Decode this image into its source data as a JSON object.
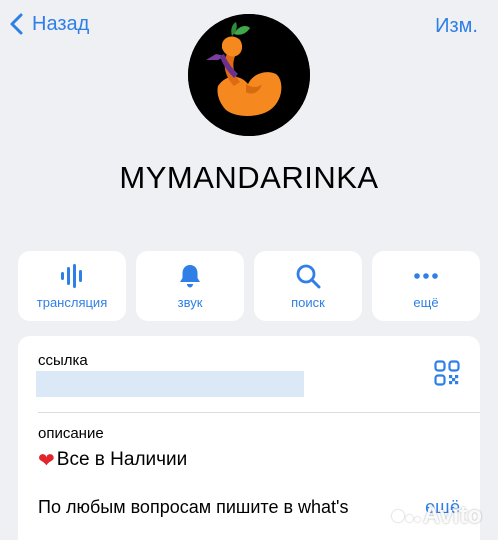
{
  "nav": {
    "back_label": "Назад",
    "edit_label": "Изм."
  },
  "channel": {
    "name": "MYMANDARINKA",
    "avatar_icon": "duck-mandarin-logo"
  },
  "actions": [
    {
      "label": "трансляция",
      "icon": "broadcast-icon"
    },
    {
      "label": "звук",
      "icon": "bell-icon"
    },
    {
      "label": "поиск",
      "icon": "search-icon"
    },
    {
      "label": "ещё",
      "icon": "more-dots-icon"
    }
  ],
  "info": {
    "link_label": "ссылка",
    "description_label": "описание",
    "description_line1": "Все в Наличии",
    "description_line2": "По любым вопросам пишите в what's",
    "more_label": "ещё"
  },
  "watermark": {
    "text": "Avito"
  },
  "colors": {
    "accent": "#2e7fe6",
    "background": "#eff0f4",
    "heart": "#e0262c"
  }
}
